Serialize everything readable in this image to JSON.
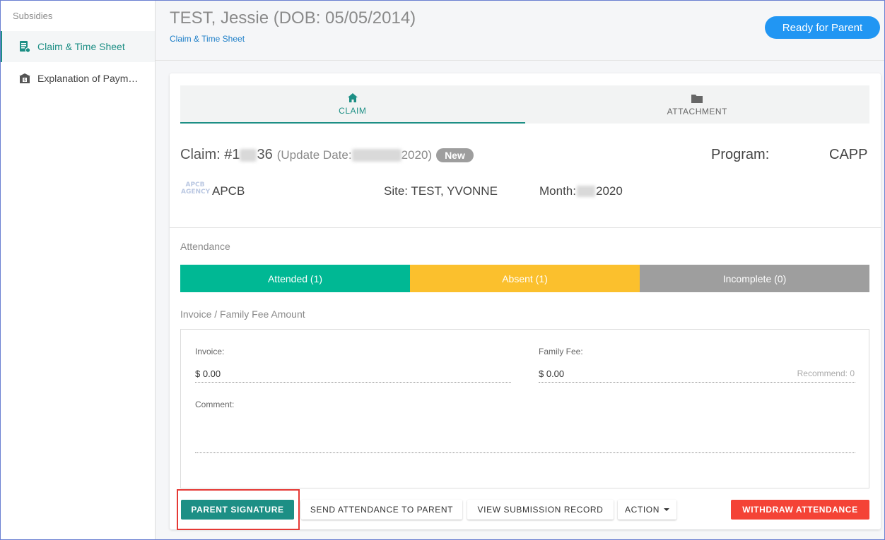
{
  "sidebar": {
    "header": "Subsidies",
    "items": [
      {
        "label": "Claim & Time Sheet",
        "icon": "clipboard-doc-icon",
        "active": true
      },
      {
        "label": "Explanation of Paym…",
        "icon": "bank-payment-icon",
        "active": false
      }
    ]
  },
  "header": {
    "title": "TEST, Jessie (DOB: 05/05/2014)",
    "breadcrumb": "Claim & Time Sheet",
    "status": "Ready for Parent"
  },
  "tabs": [
    {
      "label": "CLAIM",
      "icon": "home-icon",
      "active": true
    },
    {
      "label": "ATTACHMENT",
      "icon": "folder-icon",
      "active": false
    }
  ],
  "claim": {
    "number_prefix": "Claim: #1",
    "number_suffix": "36",
    "update_prefix": "(Update Date: ",
    "update_suffix": "2020)",
    "status_badge": "New",
    "program_label": "Program:",
    "program_value": "CAPP",
    "agency_logo_text": "APCB AGENCY",
    "agency": "APCB",
    "site": "Site: TEST, YVONNE",
    "month_prefix": "Month: ",
    "month_suffix": "2020"
  },
  "attendance": {
    "label": "Attendance",
    "segments": [
      {
        "label": "Attended (1)",
        "color": "#00b894"
      },
      {
        "label": "Absent (1)",
        "color": "#fbc02d"
      },
      {
        "label": "Incomplete (0)",
        "color": "#9e9e9e"
      }
    ]
  },
  "invoice_section": {
    "label": "Invoice / Family Fee Amount",
    "invoice_label": "Invoice:",
    "invoice_value": "$ 0.00",
    "family_fee_label": "Family Fee:",
    "family_fee_value": "$ 0.00",
    "recommend": "Recommend: 0",
    "comment_label": "Comment:"
  },
  "actions": {
    "parent_signature": "PARENT SIGNATURE",
    "send_attendance": "SEND ATTENDANCE TO PARENT",
    "view_submission": "VIEW SUBMISSION RECORD",
    "action": "ACTION",
    "withdraw": "WITHDRAW ATTENDANCE"
  },
  "colors": {
    "primary": "#1d8f85",
    "status_blue": "#2196f3",
    "danger": "#f44336",
    "highlight": "#e53935"
  }
}
